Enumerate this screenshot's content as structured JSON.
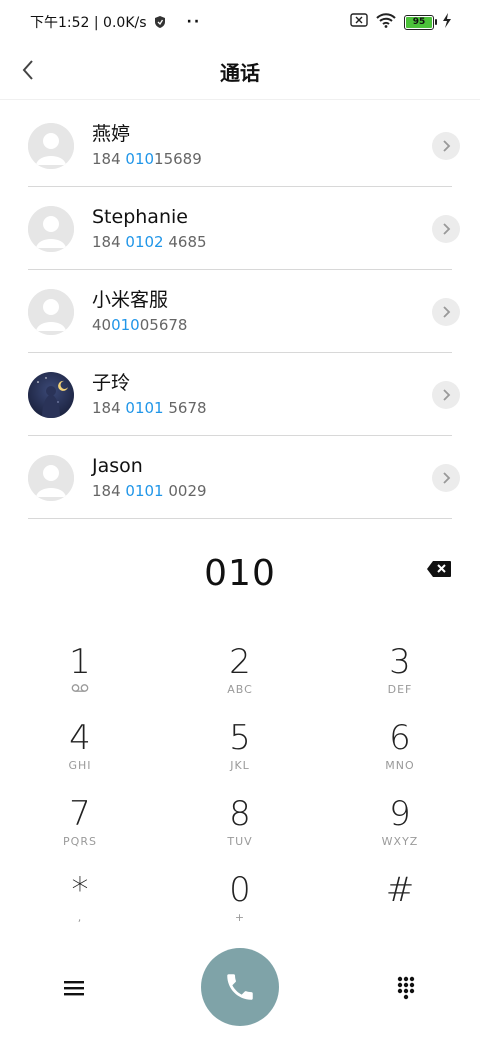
{
  "status_bar": {
    "time_speed": "下午1:52 | 0.0K/s",
    "more": "··",
    "battery_level": "95"
  },
  "header": {
    "title": "通话"
  },
  "contacts": [
    {
      "name": "燕婷",
      "number_pre": "184 ",
      "number_match": "010",
      "number_post": "15689",
      "avatar": "default-avatar"
    },
    {
      "name": "Stephanie",
      "number_pre": "184 ",
      "number_match": "0102",
      "number_post": " 4685",
      "avatar": "default-avatar"
    },
    {
      "name": "小米客服",
      "number_pre": "40",
      "number_match": "010",
      "number_post": "05678",
      "avatar": "default-avatar"
    },
    {
      "name": "子玲",
      "number_pre": "184 ",
      "number_match": "0101",
      "number_post": " 5678",
      "avatar": "photo-avatar"
    },
    {
      "name": "Jason",
      "number_pre": "184 ",
      "number_match": "0101",
      "number_post": " 0029",
      "avatar": "default-avatar"
    }
  ],
  "dial": {
    "number": "010"
  },
  "keypad": [
    {
      "digit": "1",
      "sub": "voicemail"
    },
    {
      "digit": "2",
      "sub": "ABC"
    },
    {
      "digit": "3",
      "sub": "DEF"
    },
    {
      "digit": "4",
      "sub": "GHI"
    },
    {
      "digit": "5",
      "sub": "JKL"
    },
    {
      "digit": "6",
      "sub": "MNO"
    },
    {
      "digit": "7",
      "sub": "PQRS"
    },
    {
      "digit": "8",
      "sub": "TUV"
    },
    {
      "digit": "9",
      "sub": "WXYZ"
    },
    {
      "digit": "*",
      "sub": ","
    },
    {
      "digit": "0",
      "sub": "+"
    },
    {
      "digit": "#",
      "sub": ""
    }
  ],
  "colors": {
    "highlight": "#2196e8",
    "call_button": "#7fa3a8",
    "battery": "#4cc23a"
  }
}
